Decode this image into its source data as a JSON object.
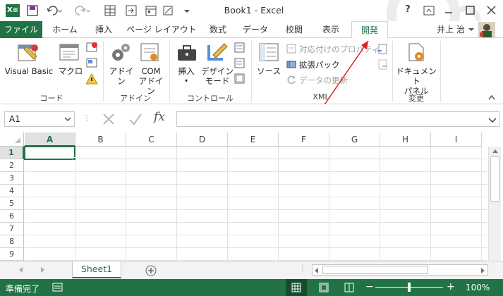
{
  "title": {
    "text": "Book1 - Excel",
    "help": "?",
    "icons": [
      "excel-logo-icon",
      "save-icon",
      "undo-icon",
      "redo-icon",
      "table-icon",
      "form-icon",
      "calendar-icon"
    ]
  },
  "tabs": {
    "file": "ファイル",
    "items": [
      "ホーム",
      "挿入",
      "ページ レイアウト",
      "数式",
      "データ",
      "校閲",
      "表示",
      "開発"
    ],
    "user": "井上 治"
  },
  "ribbon": {
    "code": {
      "label": "コード",
      "visual_basic": "Visual Basic",
      "macro": "マクロ"
    },
    "addin": {
      "label": "アドイン",
      "addin": "アドイン",
      "com1": "COM",
      "com2": "アドイン"
    },
    "controls": {
      "label": "コントロール",
      "insert": "挿入",
      "design1": "デザイン",
      "design2": "モード"
    },
    "xml": {
      "label": "XML",
      "source": "ソース",
      "map_props": "対応付けのプロパティ",
      "expansion": "拡張パック",
      "refresh": "データの更新"
    },
    "modify": {
      "label": "変更",
      "doc1": "ドキュメント",
      "doc2": "パネル"
    }
  },
  "formula_bar": {
    "name_box": "A1",
    "fx": "fx",
    "value": ""
  },
  "grid": {
    "columns": [
      "A",
      "B",
      "C",
      "D",
      "E",
      "F",
      "G",
      "H",
      "I"
    ],
    "rows": [
      "1",
      "2",
      "3",
      "4",
      "5",
      "6",
      "7",
      "8",
      "9"
    ]
  },
  "sheets": {
    "active": "Sheet1"
  },
  "status": {
    "ready": "準備完了",
    "zoom": "100%"
  },
  "colors": {
    "accent": "#217346",
    "file_tab": "#217346",
    "arrow": "#e02020"
  }
}
